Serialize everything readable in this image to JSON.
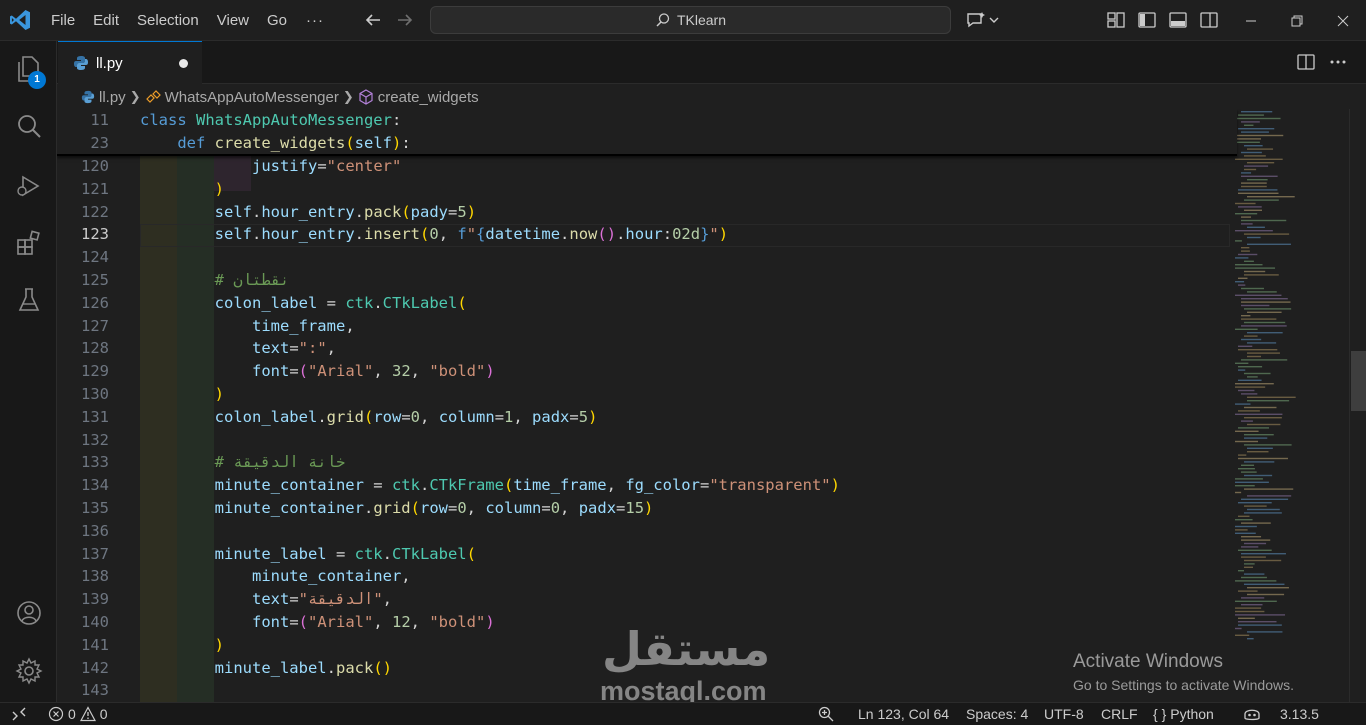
{
  "menu": [
    "File",
    "Edit",
    "Selection",
    "View",
    "Go"
  ],
  "menu_more": "···",
  "command_center": {
    "text": "TKlearn"
  },
  "explorer_badge": "1",
  "tab": {
    "label": "ll.py"
  },
  "breadcrumb": {
    "file": "ll.py",
    "class": "WhatsAppAutoMessenger",
    "method": "create_widgets"
  },
  "sticky": [
    {
      "ln": "11",
      "code": [
        [
          "kw",
          "class "
        ],
        [
          "cls",
          "WhatsAppAutoMessenger"
        ],
        [
          "op",
          ":"
        ]
      ]
    },
    {
      "ln": "23",
      "code": [
        [
          "op",
          "    "
        ],
        [
          "kw",
          "def "
        ],
        [
          "fn",
          "create_widgets"
        ],
        [
          "p1",
          "("
        ],
        [
          "var",
          "self"
        ],
        [
          "p1",
          ")"
        ],
        [
          "op",
          ":"
        ]
      ]
    }
  ],
  "lines": [
    {
      "ln": "120",
      "code": [
        [
          "op",
          "            "
        ],
        [
          "var",
          "justify"
        ],
        [
          "op",
          "="
        ],
        [
          "str",
          "\"center\""
        ]
      ]
    },
    {
      "ln": "121",
      "code": [
        [
          "op",
          "        "
        ],
        [
          "p1",
          ")"
        ]
      ]
    },
    {
      "ln": "122",
      "code": [
        [
          "op",
          "        "
        ],
        [
          "var",
          "self"
        ],
        [
          "op",
          "."
        ],
        [
          "var",
          "hour_entry"
        ],
        [
          "op",
          "."
        ],
        [
          "fn",
          "pack"
        ],
        [
          "p1",
          "("
        ],
        [
          "var",
          "pady"
        ],
        [
          "op",
          "="
        ],
        [
          "num",
          "5"
        ],
        [
          "p1",
          ")"
        ]
      ]
    },
    {
      "ln": "123",
      "current": true,
      "code": [
        [
          "op",
          "        "
        ],
        [
          "var",
          "self"
        ],
        [
          "op",
          "."
        ],
        [
          "var",
          "hour_entry"
        ],
        [
          "op",
          "."
        ],
        [
          "fn",
          "insert"
        ],
        [
          "p1",
          "("
        ],
        [
          "num",
          "0"
        ],
        [
          "op",
          ", "
        ],
        [
          "kw",
          "f"
        ],
        [
          "str",
          "\""
        ],
        [
          "kw",
          "{"
        ],
        [
          "var",
          "datetime"
        ],
        [
          "op",
          "."
        ],
        [
          "fn",
          "now"
        ],
        [
          "p2",
          "()"
        ],
        [
          "op",
          "."
        ],
        [
          "var",
          "hour"
        ],
        [
          "op",
          ":"
        ],
        [
          "num",
          "02d"
        ],
        [
          "kw",
          "}"
        ],
        [
          "str",
          "\""
        ],
        [
          "p1",
          ")"
        ]
      ]
    },
    {
      "ln": "124",
      "code": []
    },
    {
      "ln": "125",
      "code": [
        [
          "op",
          "        "
        ],
        [
          "cmt",
          "# نقطتان"
        ]
      ]
    },
    {
      "ln": "126",
      "code": [
        [
          "op",
          "        "
        ],
        [
          "var",
          "colon_label"
        ],
        [
          "op",
          " = "
        ],
        [
          "cls",
          "ctk"
        ],
        [
          "op",
          "."
        ],
        [
          "cls",
          "CTkLabel"
        ],
        [
          "p1",
          "("
        ]
      ]
    },
    {
      "ln": "127",
      "code": [
        [
          "op",
          "            "
        ],
        [
          "var",
          "time_frame"
        ],
        [
          "op",
          ","
        ]
      ]
    },
    {
      "ln": "128",
      "code": [
        [
          "op",
          "            "
        ],
        [
          "var",
          "text"
        ],
        [
          "op",
          "="
        ],
        [
          "str",
          "\":\""
        ],
        [
          "op",
          ","
        ]
      ]
    },
    {
      "ln": "129",
      "code": [
        [
          "op",
          "            "
        ],
        [
          "var",
          "font"
        ],
        [
          "op",
          "="
        ],
        [
          "p2",
          "("
        ],
        [
          "str",
          "\"Arial\""
        ],
        [
          "op",
          ", "
        ],
        [
          "num",
          "32"
        ],
        [
          "op",
          ", "
        ],
        [
          "str",
          "\"bold\""
        ],
        [
          "p2",
          ")"
        ]
      ]
    },
    {
      "ln": "130",
      "code": [
        [
          "op",
          "        "
        ],
        [
          "p1",
          ")"
        ]
      ]
    },
    {
      "ln": "131",
      "code": [
        [
          "op",
          "        "
        ],
        [
          "var",
          "colon_label"
        ],
        [
          "op",
          "."
        ],
        [
          "fn",
          "grid"
        ],
        [
          "p1",
          "("
        ],
        [
          "var",
          "row"
        ],
        [
          "op",
          "="
        ],
        [
          "num",
          "0"
        ],
        [
          "op",
          ", "
        ],
        [
          "var",
          "column"
        ],
        [
          "op",
          "="
        ],
        [
          "num",
          "1"
        ],
        [
          "op",
          ", "
        ],
        [
          "var",
          "padx"
        ],
        [
          "op",
          "="
        ],
        [
          "num",
          "5"
        ],
        [
          "p1",
          ")"
        ]
      ]
    },
    {
      "ln": "132",
      "code": []
    },
    {
      "ln": "133",
      "code": [
        [
          "op",
          "        "
        ],
        [
          "cmt",
          "# خانة الدقيقة"
        ]
      ]
    },
    {
      "ln": "134",
      "code": [
        [
          "op",
          "        "
        ],
        [
          "var",
          "minute_container"
        ],
        [
          "op",
          " = "
        ],
        [
          "cls",
          "ctk"
        ],
        [
          "op",
          "."
        ],
        [
          "cls",
          "CTkFrame"
        ],
        [
          "p1",
          "("
        ],
        [
          "var",
          "time_frame"
        ],
        [
          "op",
          ", "
        ],
        [
          "var",
          "fg_color"
        ],
        [
          "op",
          "="
        ],
        [
          "str",
          "\"transparent\""
        ],
        [
          "p1",
          ")"
        ]
      ]
    },
    {
      "ln": "135",
      "code": [
        [
          "op",
          "        "
        ],
        [
          "var",
          "minute_container"
        ],
        [
          "op",
          "."
        ],
        [
          "fn",
          "grid"
        ],
        [
          "p1",
          "("
        ],
        [
          "var",
          "row"
        ],
        [
          "op",
          "="
        ],
        [
          "num",
          "0"
        ],
        [
          "op",
          ", "
        ],
        [
          "var",
          "column"
        ],
        [
          "op",
          "="
        ],
        [
          "num",
          "0"
        ],
        [
          "op",
          ", "
        ],
        [
          "var",
          "padx"
        ],
        [
          "op",
          "="
        ],
        [
          "num",
          "15"
        ],
        [
          "p1",
          ")"
        ]
      ]
    },
    {
      "ln": "136",
      "code": []
    },
    {
      "ln": "137",
      "code": [
        [
          "op",
          "        "
        ],
        [
          "var",
          "minute_label"
        ],
        [
          "op",
          " = "
        ],
        [
          "cls",
          "ctk"
        ],
        [
          "op",
          "."
        ],
        [
          "cls",
          "CTkLabel"
        ],
        [
          "p1",
          "("
        ]
      ]
    },
    {
      "ln": "138",
      "code": [
        [
          "op",
          "            "
        ],
        [
          "var",
          "minute_container"
        ],
        [
          "op",
          ","
        ]
      ]
    },
    {
      "ln": "139",
      "code": [
        [
          "op",
          "            "
        ],
        [
          "var",
          "text"
        ],
        [
          "op",
          "="
        ],
        [
          "str",
          "\"الدقيقة\""
        ],
        [
          "op",
          ","
        ]
      ]
    },
    {
      "ln": "140",
      "code": [
        [
          "op",
          "            "
        ],
        [
          "var",
          "font"
        ],
        [
          "op",
          "="
        ],
        [
          "p2",
          "("
        ],
        [
          "str",
          "\"Arial\""
        ],
        [
          "op",
          ", "
        ],
        [
          "num",
          "12"
        ],
        [
          "op",
          ", "
        ],
        [
          "str",
          "\"bold\""
        ],
        [
          "p2",
          ")"
        ]
      ]
    },
    {
      "ln": "141",
      "code": [
        [
          "op",
          "        "
        ],
        [
          "p1",
          ")"
        ]
      ]
    },
    {
      "ln": "142",
      "code": [
        [
          "op",
          "        "
        ],
        [
          "var",
          "minute_label"
        ],
        [
          "op",
          "."
        ],
        [
          "fn",
          "pack"
        ],
        [
          "p1",
          "()"
        ]
      ]
    },
    {
      "ln": "143",
      "code": []
    }
  ],
  "watermark": {
    "arabic": "مستقل",
    "latin": "mostaql.com"
  },
  "activate": {
    "title": "Activate Windows",
    "subtitle": "Go to Settings to activate Windows."
  },
  "status": {
    "errors": "0",
    "warnings": "0",
    "position": "Ln 123, Col 64",
    "spaces": "Spaces: 4",
    "encoding": "UTF-8",
    "eol": "CRLF",
    "language": "Python",
    "language_prefix": "{ }",
    "version": "3.13.5"
  },
  "colors": {
    "accent": "#0078d4",
    "background": "#1f1f1f",
    "sidebar": "#181818"
  }
}
